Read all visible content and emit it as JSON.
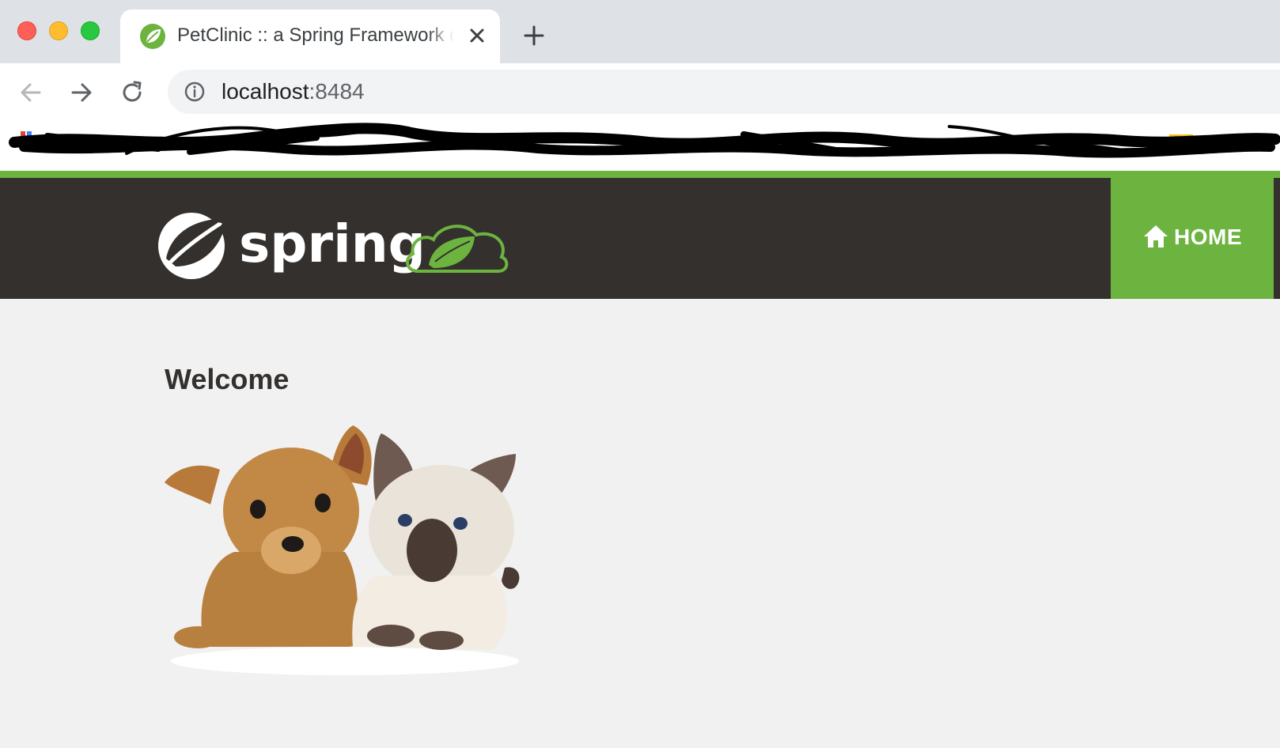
{
  "browser": {
    "tab": {
      "title": "PetClinic :: a Spring Framework demonstration",
      "favicon": "spring-leaf-icon"
    },
    "address": {
      "host": "localhost",
      "port": ":8484"
    },
    "icons": {
      "back": "arrow-left-icon",
      "forward": "arrow-right-icon",
      "reload": "reload-icon",
      "site_info": "info-icon",
      "close_tab": "close-icon",
      "new_tab": "plus-icon"
    }
  },
  "app": {
    "brand": "spring",
    "nav": {
      "home_label": "HOME",
      "home_icon": "home-icon"
    },
    "colors": {
      "navbar_bg": "#34302d",
      "accent_green": "#6db33f",
      "page_bg": "#f1f1f1"
    },
    "main": {
      "heading": "Welcome",
      "image": "pets-image"
    }
  }
}
